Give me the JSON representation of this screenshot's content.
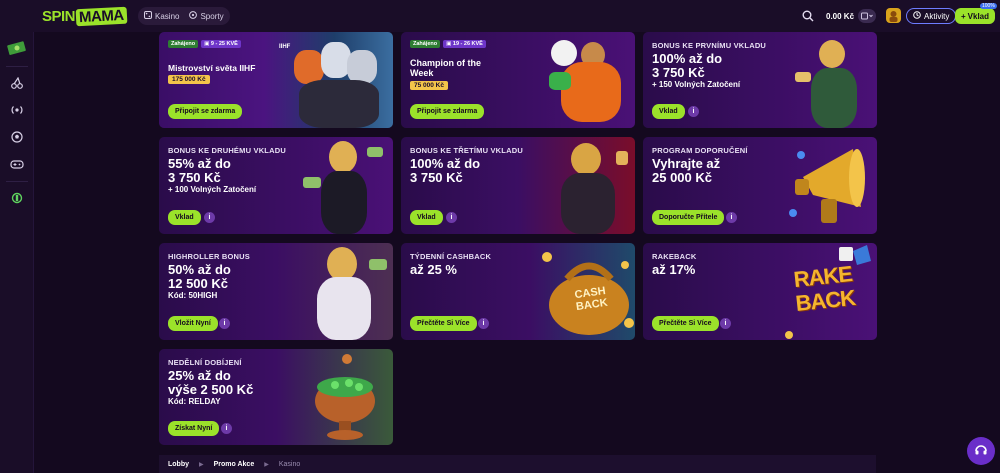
{
  "header": {
    "logo_spin": "SPIN",
    "logo_mama": "MAMA",
    "nav": [
      {
        "label": "Kasino",
        "icon": "dice-icon"
      },
      {
        "label": "Sporty",
        "icon": "ball-icon"
      }
    ],
    "balance": "0.00 Kč",
    "aktivity_label": "Aktivity",
    "vklad_label": "Vklad",
    "vklad_badge": "100%"
  },
  "sidebar": {
    "items": [
      {
        "icon": "menu-icon"
      },
      {
        "icon": "cash-icon"
      },
      {
        "icon": "cherry-icon"
      },
      {
        "icon": "live-icon"
      },
      {
        "icon": "football-icon"
      },
      {
        "icon": "gamepad-icon"
      },
      {
        "icon": "support-icon"
      }
    ]
  },
  "cards": [
    {
      "tag_status": "Zahájeno",
      "tag_date": "9 - 25 KVĚ",
      "title": "Mistrovství světa IIHF",
      "prize": "175 000 Kč",
      "cta": "Připojit se zdarma"
    },
    {
      "tag_status": "Zahájeno",
      "tag_date": "19 - 26 KVĚ",
      "title": "Champion of the Week",
      "prize": "75 000 Kč",
      "cta": "Připojit se zdarma"
    },
    {
      "eyebrow": "BONUS KE PRVNÍMU VKLADU",
      "headline1": "100% až do",
      "headline2": "3 750 Kč",
      "sub": "+ 150 Volných Zatočení",
      "cta": "Vklad"
    },
    {
      "eyebrow": "BONUS KE DRUHÉMU VKLADU",
      "headline1": "55% až do",
      "headline2": "3 750 Kč",
      "sub": "+ 100 Volných Zatočení",
      "cta": "Vklad"
    },
    {
      "eyebrow": "BONUS KE TŘETÍMU VKLADU",
      "headline1": "100% až do",
      "headline2": "3 750 Kč",
      "sub": "",
      "cta": "Vklad"
    },
    {
      "eyebrow": "PROGRAM DOPORUČENÍ",
      "headline1": "Vyhrajte až",
      "headline2": "25 000 Kč",
      "sub": "",
      "cta": "Doporučte Přítele"
    },
    {
      "eyebrow": "HIGHROLLER BONUS",
      "headline1": "50% až do",
      "headline2": "12 500 Kč",
      "sub": "Kód: 50HIGH",
      "cta": "Vložit Nyní"
    },
    {
      "eyebrow": "TÝDENNÍ CASHBACK",
      "headline1": "až 25 %",
      "headline2": "",
      "sub": "",
      "cta": "Přečtěte Si Více",
      "art_text": "CASH BACK"
    },
    {
      "eyebrow": "RAKEBACK",
      "headline1": "až 17%",
      "headline2": "",
      "sub": "",
      "cta": "Přečtěte Si Více",
      "art_text": "RAKE BACK"
    },
    {
      "eyebrow": "NEDĚLNÍ DOBÍJENÍ",
      "headline1": "25% až do",
      "headline2": "výše 2 500 Kč",
      "sub": "Kód: RELDAY",
      "cta": "Získat Nyní"
    }
  ],
  "info_symbol": "i",
  "breadcrumb": [
    "Lobby",
    "Promo Akce",
    "Kasino"
  ]
}
